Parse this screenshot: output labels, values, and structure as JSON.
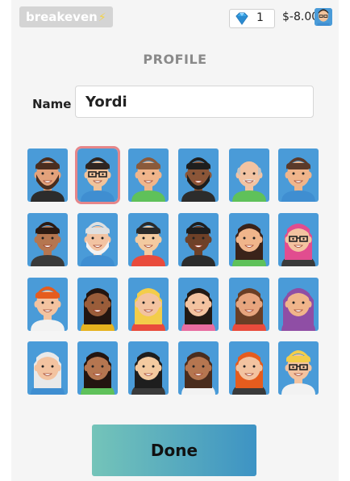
{
  "topbar": {
    "brand": "breakeven",
    "gem_count": "1",
    "balance": "$-8.00"
  },
  "profile": {
    "title": "PROFILE",
    "name_label": "Name",
    "name_value": "Yordi",
    "done_label": "Done"
  },
  "colors": {
    "tile_background": "#4a9bd8",
    "selected_border": "#e6868a",
    "done_gradient_start": "#74c4b9",
    "done_gradient_end": "#3d93c4"
  },
  "avatars": {
    "selected_index": 1,
    "items": [
      {
        "name": "bearded-man",
        "skin": "#e3a27b",
        "hair": "#4a2d1e",
        "shirt": "#2c2c2c",
        "beard": "full",
        "glasses": false
      },
      {
        "name": "man-with-glasses",
        "skin": "#f1c39b",
        "hair": "#2f2520",
        "shirt": "#3f8ed1",
        "beard": "none",
        "glasses": true
      },
      {
        "name": "smiling-man-green-shirt",
        "skin": "#f0b58b",
        "hair": "#8a5a3b",
        "shirt": "#5fc15a",
        "beard": "none",
        "glasses": false
      },
      {
        "name": "dark-skinned-bearded-man",
        "skin": "#8b5638",
        "hair": "#1e1e1e",
        "shirt": "#2c2c2c",
        "beard": "full",
        "glasses": false
      },
      {
        "name": "bald-old-man",
        "skin": "#f2c3a2",
        "hair": "#c5c5c5",
        "shirt": "#5fc15a",
        "beard": "mustache",
        "glasses": false
      },
      {
        "name": "young-man-brown-hair",
        "skin": "#f0b58b",
        "hair": "#5b3a2a",
        "shirt": "#3f8ed1",
        "beard": "none",
        "glasses": false
      },
      {
        "name": "curly-haired-man",
        "skin": "#b57650",
        "hair": "#2c1a12",
        "shirt": "#3a3a3a",
        "beard": "none",
        "glasses": false
      },
      {
        "name": "old-man-white-beard",
        "skin": "#f2c3a2",
        "hair": "#e0e0e0",
        "shirt": "#3f8ed1",
        "beard": "white",
        "glasses": false
      },
      {
        "name": "asian-man",
        "skin": "#f3caa0",
        "hair": "#2a2a2a",
        "shirt": "#e94b3c",
        "beard": "none",
        "glasses": false
      },
      {
        "name": "dark-skinned-man",
        "skin": "#6e4128",
        "hair": "#1e1e1e",
        "shirt": "#2c2c2c",
        "beard": "none",
        "glasses": false
      },
      {
        "name": "woman-dark-bun",
        "skin": "#f0b58b",
        "hair": "#3a231a",
        "shirt": "#5fc15a",
        "beard": "none",
        "glasses": false
      },
      {
        "name": "woman-pink-hair-glasses",
        "skin": "#f3c3a0",
        "hair": "#e14d8f",
        "shirt": "#3a3a3a",
        "beard": "none",
        "glasses": true
      },
      {
        "name": "redhead-man",
        "skin": "#f3c3a0",
        "hair": "#e55c1e",
        "shirt": "#f2f2f2",
        "beard": "none",
        "glasses": false
      },
      {
        "name": "dark-skinned-woman",
        "skin": "#9a5d3a",
        "hair": "#231510",
        "shirt": "#e6b21e",
        "beard": "none",
        "glasses": false
      },
      {
        "name": "blonde-woman",
        "skin": "#f3c3a0",
        "hair": "#f3cd4a",
        "shirt": "#e94b3c",
        "beard": "none",
        "glasses": false
      },
      {
        "name": "smiling-woman-dark-hair",
        "skin": "#f3c3a0",
        "hair": "#231a14",
        "shirt": "#e86ca0",
        "beard": "none",
        "glasses": false
      },
      {
        "name": "woman-brown-hair",
        "skin": "#e7a57e",
        "hair": "#6a3e25",
        "shirt": "#e94b3c",
        "beard": "none",
        "glasses": false
      },
      {
        "name": "woman-hijab",
        "skin": "#f0b58b",
        "hair": "#8f4ea5",
        "shirt": "#8f4ea5",
        "beard": "none",
        "glasses": false
      },
      {
        "name": "old-woman-white-hair",
        "skin": "#f3c3a0",
        "hair": "#e9e9e9",
        "shirt": "#3f8ed1",
        "beard": "none",
        "glasses": false
      },
      {
        "name": "woman-long-dark-hair",
        "skin": "#b57650",
        "hair": "#231510",
        "shirt": "#5fc15a",
        "beard": "none",
        "glasses": false
      },
      {
        "name": "asian-woman",
        "skin": "#f3caa0",
        "hair": "#1e1e1e",
        "shirt": "#3a3a3a",
        "beard": "none",
        "glasses": false
      },
      {
        "name": "woman-curly-hair",
        "skin": "#b57650",
        "hair": "#4a2d1e",
        "shirt": "#f2f2f2",
        "beard": "none",
        "glasses": false
      },
      {
        "name": "redhead-woman",
        "skin": "#f3c3a0",
        "hair": "#e55c1e",
        "shirt": "#3a3a3a",
        "beard": "none",
        "glasses": false
      },
      {
        "name": "blonde-man-glasses",
        "skin": "#f3c3a0",
        "hair": "#f3cd4a",
        "shirt": "#f2f2f2",
        "beard": "none",
        "glasses": true
      }
    ]
  }
}
